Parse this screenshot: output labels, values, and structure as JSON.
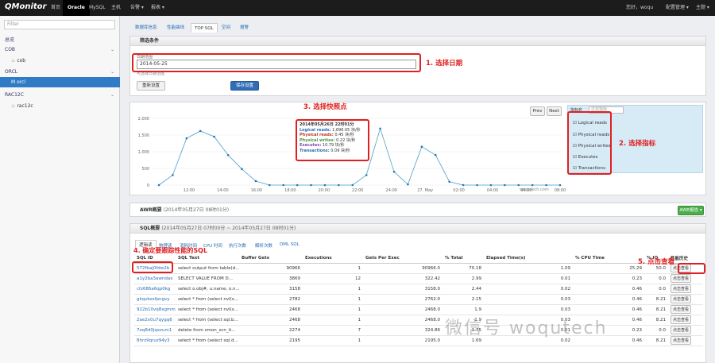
{
  "nav": {
    "brand": "QMonitor",
    "items": [
      "首页",
      "Oracle",
      "MySQL",
      "主机",
      "告警 ▾",
      "报表 ▾"
    ],
    "active": "Oracle",
    "user": "您好，woqu",
    "settings": "配置管理 ▾",
    "theme": "主题 ▾"
  },
  "sidebar": {
    "filter_placeholder": "Filter",
    "overview": "总览",
    "groups": [
      {
        "name": "COB",
        "items": [
          "cob"
        ]
      },
      {
        "name": "ORCL",
        "items": [
          "M orcl"
        ]
      },
      {
        "name": "RAC12C",
        "items": [
          "rac12c"
        ]
      }
    ]
  },
  "tabs": [
    "数据库信息",
    "性能曲线",
    "TOP SQL",
    "空间",
    "报警"
  ],
  "active_tab": "TOP SQL",
  "filter_panel": {
    "title": "筛选条件",
    "field_label": "日期范围",
    "date_value": "2014-05-25",
    "hint": "可选择日期范围",
    "reset": "重新设置",
    "save": "保存设置"
  },
  "annotations": {
    "a1": "1. 选择日期",
    "a2": "2. 选择指标",
    "a3": "3. 选择快照点",
    "a4": "4. 确定要跟踪性能的SQL",
    "a5": "5. 点击查看"
  },
  "chart": {
    "prev": "Prev",
    "next": "Next",
    "metric_header": "指标名",
    "metric_filter": "过滤指标",
    "watermark": "woqutech.com",
    "yticks": [
      "2,000",
      "1,500",
      "1,000",
      "500",
      "0"
    ],
    "xticks": [
      "12:00",
      "14:00",
      "16:00",
      "18:00",
      "20:00",
      "22:00",
      "24:00",
      "02:00",
      "04:00",
      "06:00",
      "08:00"
    ],
    "xtick_mid": "27. May",
    "metrics": [
      "Logical reads",
      "Physical reads",
      "Physical writes",
      "Executes",
      "Transactions"
    ],
    "tooltip": {
      "title": "2014年05月26日 22时01分",
      "lines": [
        {
          "label": "Logical reads:",
          "value": "1,696.05 块/秒"
        },
        {
          "label": "Physical reads:",
          "value": "0.45 块/秒"
        },
        {
          "label": "Physical writes:",
          "value": "0.22 块/秒"
        },
        {
          "label": "Executes:",
          "value": "10.79 块/秒"
        },
        {
          "label": "Transactions:",
          "value": "0.09 块/秒"
        }
      ]
    }
  },
  "chart_data": {
    "type": "line",
    "ylim": [
      0,
      2000
    ],
    "series": [
      {
        "name": "Logical reads",
        "x": [
          "11:00",
          "11:30",
          "12:00",
          "12:30",
          "13:00",
          "13:30",
          "14:00",
          "14:30",
          "15:00",
          "16:00",
          "17:00",
          "18:00",
          "19:00",
          "20:00",
          "21:00",
          "21:30",
          "22:00",
          "22:30",
          "23:00",
          "23:30",
          "24:00",
          "00:30",
          "01:00",
          "02:00",
          "03:00",
          "04:00",
          "05:00",
          "06:00",
          "07:00",
          "08:00"
        ],
        "values": [
          0,
          300,
          1400,
          1620,
          1450,
          900,
          480,
          120,
          0,
          0,
          0,
          0,
          0,
          0,
          0,
          300,
          1696,
          400,
          20,
          1150,
          900,
          100,
          0,
          0,
          0,
          0,
          0,
          0,
          0,
          0
        ]
      }
    ]
  },
  "awr": {
    "title": "AWR概要",
    "range": "(2014年05月27日 08时01分)",
    "button": "AWR报告 ▾"
  },
  "sql": {
    "title": "SQL概要",
    "range": "(2014年05月27日 07时00分 ~ 2014年05月27日 08时01分)",
    "tabs": [
      "逻辑读",
      "物理读",
      "消耗时间",
      "CPU 时间",
      "执行次数",
      "解析次数",
      "DML SQL"
    ],
    "headers": [
      "SQL ID",
      "SQL Text",
      "Buffer Gets",
      "Executions",
      "Gets Per Exec",
      "% Total",
      "Elapsed Time(s)",
      "% CPU Time",
      "% IO",
      "性能历史"
    ],
    "view": "点击查看",
    "rows": [
      [
        "572fbaj0fdw2b",
        "select output from table(d...",
        "90966",
        "1",
        "90966.0",
        "70.18",
        "1.09",
        "25.29",
        "50.0"
      ],
      [
        "a1y2ba3awndax",
        "SELECT VALUE FROM D...",
        "3869",
        "12",
        "322.42",
        "2.99",
        "0.01",
        "0.23",
        "0.0"
      ],
      [
        "cfz686a6qp0kg",
        "select o.obj#, u.name, o.n...",
        "3158",
        "1",
        "3158.0",
        "2.44",
        "0.02",
        "0.46",
        "0.0"
      ],
      [
        "gkqvbzsfpngvy",
        "select * from (select nvl(s...",
        "2782",
        "1",
        "2762.0",
        "2.15",
        "0.03",
        "0.46",
        "8.21"
      ],
      [
        "922b10vq8xgmm",
        "select * from (select nvl(s...",
        "2468",
        "1",
        "2468.0",
        "1.9",
        "0.03",
        "0.46",
        "8.21"
      ],
      [
        "2ae2x0u7qygq6",
        "select * from (select sql.b...",
        "2468",
        "1",
        "2468.0",
        "1.9",
        "0.03",
        "0.46",
        "8.21"
      ],
      [
        "7oq8d0jqxzum1",
        "delete from smon_scn_ti...",
        "2274",
        "7",
        "324.86",
        "1.75",
        "0.01",
        "0.23",
        "0.0"
      ],
      [
        "8hrz9qruz94y3",
        "select * from (select sql.d...",
        "2195",
        "1",
        "2195.0",
        "1.69",
        "0.02",
        "0.46",
        "8.21"
      ]
    ]
  },
  "watermark": "微信号 woqutech"
}
